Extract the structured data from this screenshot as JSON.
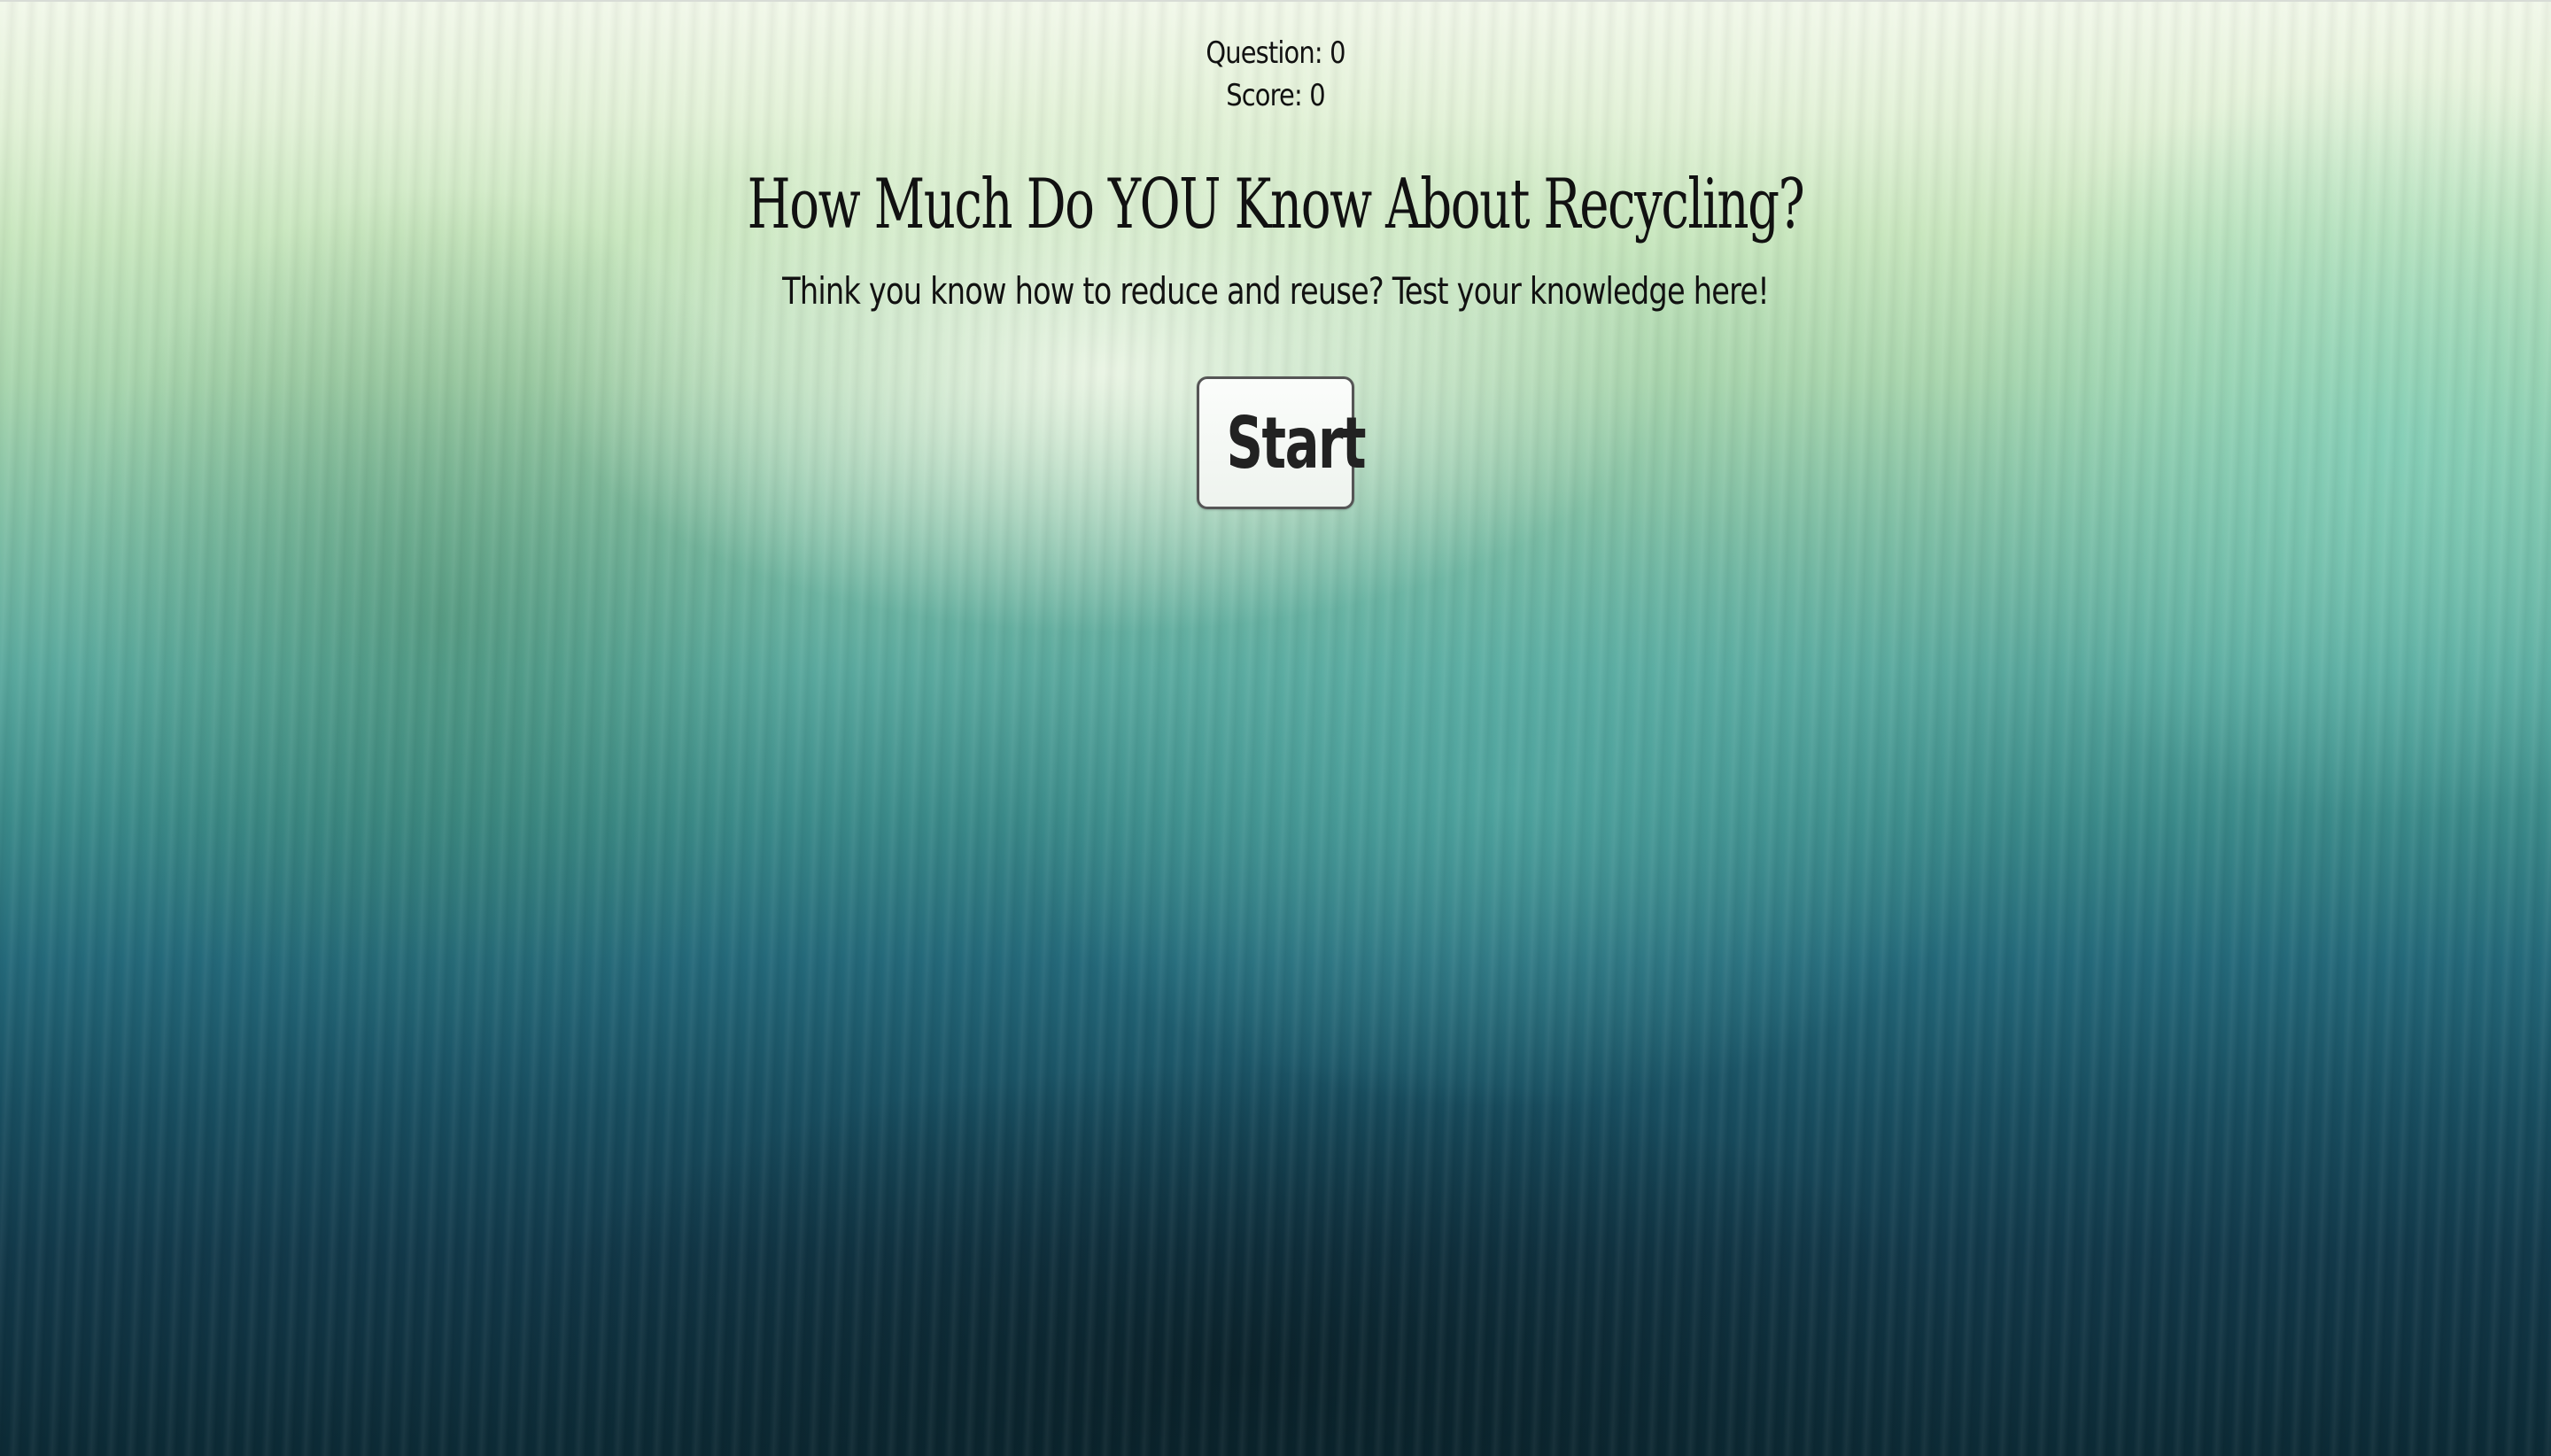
{
  "quiz": {
    "question_text": "Question: 0",
    "score_text": "Score: 0",
    "title": "How Much Do YOU Know About Recycling?",
    "subtitle": "Think you know how to reduce and reuse? Test your knowledge here!",
    "start_label": "Start"
  },
  "colors": {
    "text": "#111111",
    "button_border": "#555555",
    "button_background": "#f5f8f5"
  }
}
